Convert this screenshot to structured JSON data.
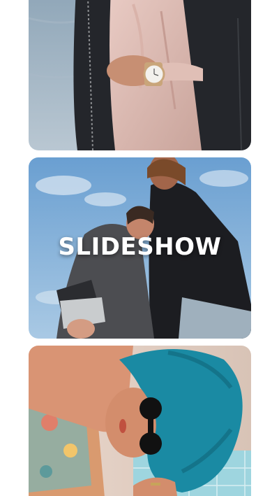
{
  "slides": [
    {
      "image": "leather-jacket-watch-photo"
    },
    {
      "image": "two-women-sky-photo",
      "title": "SLIDESHOW"
    },
    {
      "image": "blue-hair-sunglasses-photo"
    }
  ]
}
